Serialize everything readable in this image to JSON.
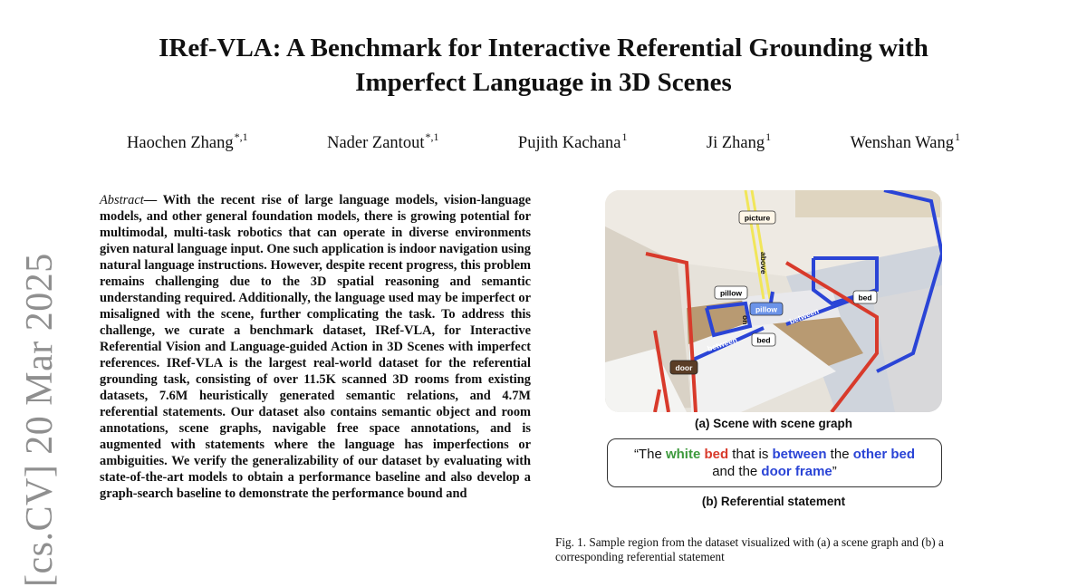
{
  "stamp": "[cs.CV]  20 Mar 2025",
  "title_line1": "IRef-VLA: A Benchmark for Interactive Referential Grounding with",
  "title_line2": "Imperfect Language in 3D Scenes",
  "authors": [
    {
      "name": "Haochen Zhang",
      "sup": "*,1"
    },
    {
      "name": "Nader Zantout",
      "sup": "*,1"
    },
    {
      "name": "Pujith Kachana",
      "sup": "1"
    },
    {
      "name": "Ji Zhang",
      "sup": "1"
    },
    {
      "name": "Wenshan Wang",
      "sup": "1"
    }
  ],
  "abstract_label": "Abstract",
  "abstract_dash": "— ",
  "abstract_text": "With the recent rise of large language models, vision-language models, and other general foundation models, there is growing potential for multimodal, multi-task robotics that can operate in diverse environments given natural language input. One such application is indoor navigation using natural language instructions. However, despite recent progress, this problem remains challenging due to the 3D spatial reasoning and semantic understanding required. Additionally, the language used may be imperfect or misaligned with the scene, further complicating the task. To address this challenge, we curate a benchmark dataset, IRef-VLA, for Interactive Referential Vision and Language-guided Action in 3D Scenes with imperfect references. IRef-VLA is the largest real-world dataset for the referential grounding task, consisting of over 11.5K scanned 3D rooms from existing datasets, 7.6M heuristically generated semantic relations, and 4.7M referential statements. Our dataset also contains semantic object and room annotations, scene graphs, navigable free space annotations, and is augmented with statements where the language has imperfections or ambiguities. We verify the generalizability of our dataset by evaluating with state-of-the-art models to obtain a performance baseline and also develop a graph-search baseline to demonstrate the performance bound and",
  "figure_labels": {
    "picture": "picture",
    "above": "above",
    "pillow1": "pillow",
    "pillow2": "pillow",
    "on": "on",
    "bed_center": "bed",
    "bed_right": "bed",
    "between1": "between",
    "between2": "between",
    "door": "door"
  },
  "caption_a": "(a)  Scene with scene graph",
  "statement": {
    "q_open": "“The ",
    "w_white": "white",
    "s1": " ",
    "w_bed": "bed",
    "s2": " that is ",
    "w_between": "between",
    "s3": " the ",
    "w_other_bed": "other bed",
    "s4": "and the ",
    "w_door_frame": "door frame",
    "q_close": "”"
  },
  "caption_b": "(b) Referential statement",
  "fig_caption": "Fig. 1.   Sample region from the dataset visualized with (a) a scene graph and (b) a corresponding referential statement",
  "colors": {
    "green": "#3d9a3d",
    "red": "#d83a2b",
    "blue": "#2a44d6",
    "stamp_gray": "#8f8f8f"
  }
}
